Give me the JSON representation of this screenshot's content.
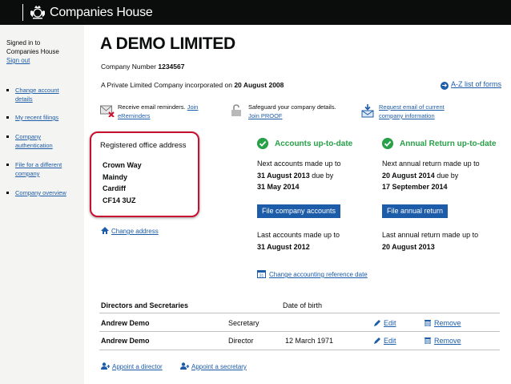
{
  "header": {
    "brand": "Companies House",
    "crest_icon": "royal-crest-icon"
  },
  "sidebar": {
    "signed_in_line1": "Signed in to",
    "signed_in_line2": "Companies House",
    "sign_out": "Sign out",
    "items": [
      {
        "line1": "Change account",
        "line2": "details"
      },
      {
        "line1": "My recent filings",
        "line2": ""
      },
      {
        "line1": "Company",
        "line2": "authentication"
      },
      {
        "line1": "File for a different",
        "line2": "company"
      },
      {
        "line1": "Company overview",
        "line2": ""
      }
    ]
  },
  "company": {
    "name": "A DEMO LIMITED",
    "number_label": "Company Number",
    "number": "1234567",
    "incorporation_text": "A Private Limited Company incorporated on",
    "incorporation_date": "20 August 2008",
    "az_link": "A-Z list of forms"
  },
  "services": {
    "ereminders_text": "Receive email reminders.",
    "ereminders_link1": "Join",
    "ereminders_link2": "eReminders",
    "proof_text": "Safeguard your company details.",
    "proof_link": "Join PROOF",
    "email_link1": "Request email of current",
    "email_link2": "company information"
  },
  "office": {
    "heading": "Registered office address",
    "lines": [
      "Crown Way",
      "Maindy",
      "Cardiff",
      "CF14 3UZ"
    ],
    "change_link": "Change address"
  },
  "accounts": {
    "status": "Accounts up-to-date",
    "next_label": "Next accounts made up to",
    "next_date": "31 August 2013",
    "due_by": "due by",
    "due_date": "31 May 2014",
    "button": "File company accounts",
    "last_label": "Last accounts made up to",
    "last_date": "31 August 2012",
    "change_ref_link": "Change accounting reference date"
  },
  "annual_return": {
    "status": "Annual Return up-to-date",
    "next_label": "Next annual return made up to",
    "next_date": "20 August 2014",
    "due_by": "due by",
    "due_date": "17 September 2014",
    "button": "File annual return",
    "last_label": "Last annual return made up to",
    "last_date": "20 August 2013"
  },
  "directors": {
    "heading": "Directors and Secretaries",
    "dob_heading": "Date of birth",
    "rows": [
      {
        "name": "Andrew Demo",
        "role": "Secretary",
        "dob": "",
        "edit": "Edit",
        "remove": "Remove"
      },
      {
        "name": "Andrew Demo",
        "role": "Director",
        "dob": "12 March 1971",
        "edit": "Edit",
        "remove": "Remove"
      }
    ],
    "appoint_director": "Appoint a director",
    "appoint_secretary": "Appoint a secretary"
  },
  "colors": {
    "link": "#1d5ca8",
    "success": "#28a148",
    "highlight": "#c8102e",
    "header": "#0b0c0c"
  }
}
